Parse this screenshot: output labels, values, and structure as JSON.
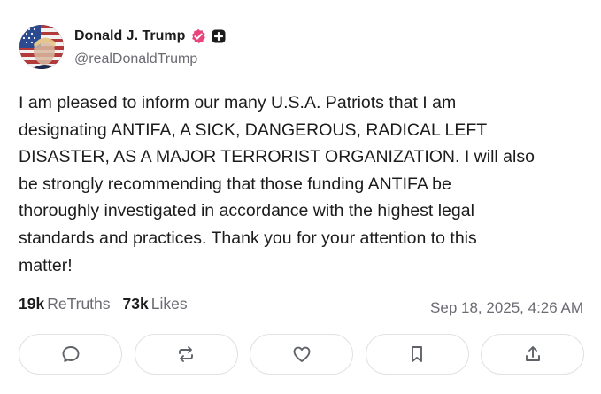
{
  "author": {
    "display_name": "Donald J. Trump",
    "handle": "@realDonaldTrump",
    "verified_icon": "verified-badge-icon",
    "plus_icon": "plus-badge-icon",
    "avatar": "profile-avatar"
  },
  "post": {
    "lines": [
      "I am pleased to inform our many U.S.A. Patriots that I am",
      "designating ANTIFA, A SICK, DANGEROUS, RADICAL LEFT",
      "DISASTER, AS A MAJOR TERRORIST ORGANIZATION. I will also",
      "be strongly recommending that those funding ANTIFA be",
      "thoroughly investigated in accordance with the highest legal",
      "standards and practices. Thank you for your attention to this",
      "matter!"
    ]
  },
  "stats": {
    "retruths_count": "19k",
    "retruths_label": "ReTruths",
    "likes_count": "73k",
    "likes_label": "Likes"
  },
  "timestamp": "Sep 18, 2025, 4:26 AM",
  "actions": [
    {
      "name": "reply",
      "icon": "comment-icon"
    },
    {
      "name": "retruth",
      "icon": "repost-icon"
    },
    {
      "name": "like",
      "icon": "heart-icon"
    },
    {
      "name": "bookmark",
      "icon": "bookmark-icon"
    },
    {
      "name": "share",
      "icon": "share-icon"
    }
  ],
  "colors": {
    "text": "#1c1c1c",
    "muted": "#6b6b73",
    "verified_badge": "#e8457c",
    "button_border": "#e1e1e6",
    "icon": "#5f6368"
  }
}
